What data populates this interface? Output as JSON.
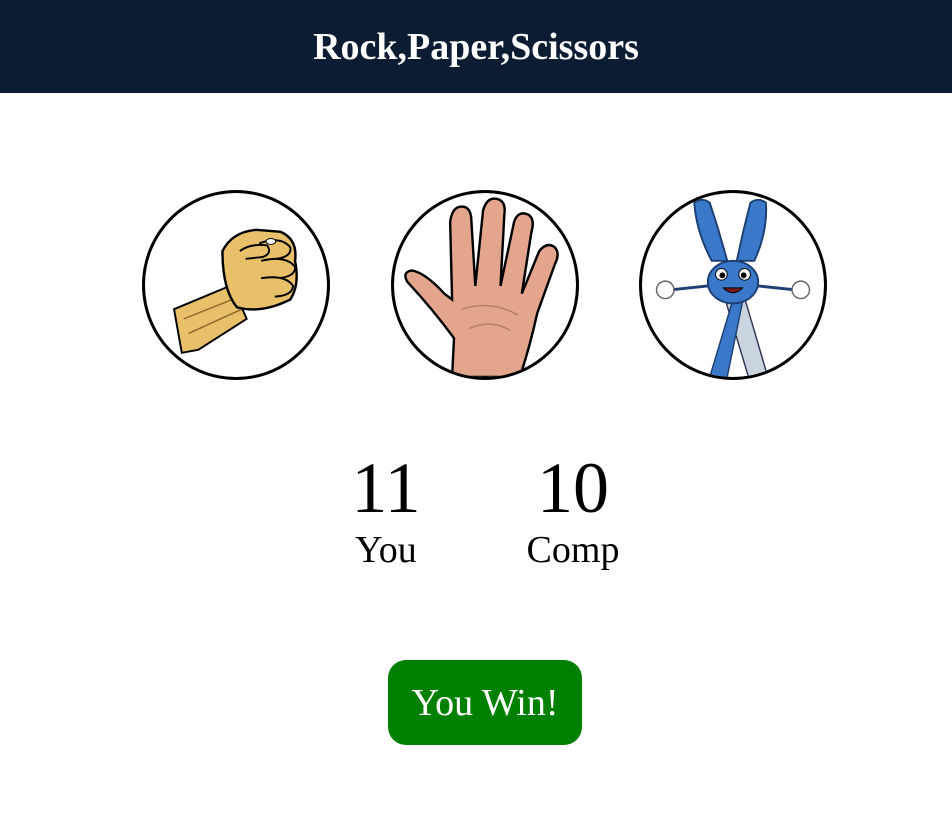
{
  "header": {
    "title": "Rock,Paper,Scissors"
  },
  "choices": [
    {
      "id": "rock",
      "icon": "rock-fist-icon"
    },
    {
      "id": "paper",
      "icon": "paper-hand-icon"
    },
    {
      "id": "scissors",
      "icon": "scissors-character-icon"
    }
  ],
  "scoreboard": {
    "user": {
      "score": "11",
      "label": "You"
    },
    "comp": {
      "score": "10",
      "label": "Comp"
    }
  },
  "message": {
    "text": "You Win!",
    "color": "#008000"
  },
  "colors": {
    "header_bg": "#0b1c33",
    "header_text": "#ffffff"
  }
}
